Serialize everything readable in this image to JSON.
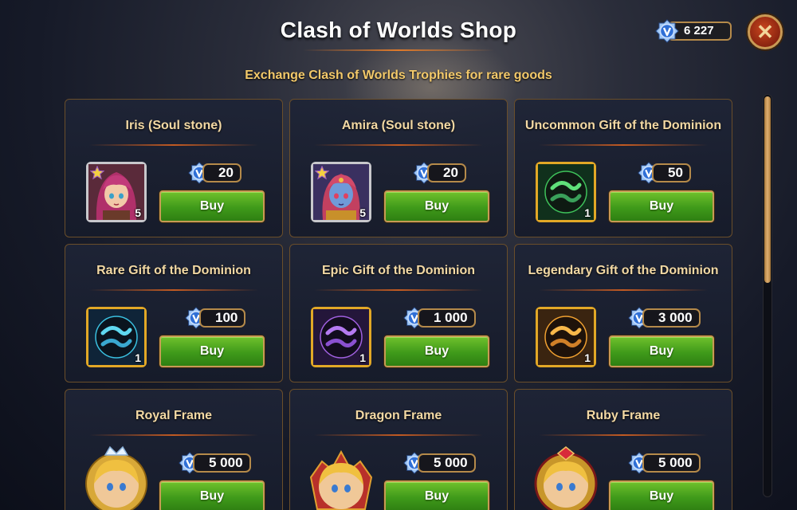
{
  "shop": {
    "title": "Clash of Worlds Shop",
    "subtitle": "Exchange Clash of Worlds Trophies for rare goods",
    "balance": "6 227",
    "buy_label": "Buy"
  },
  "colors": {
    "accent_gold": "#f3c96a",
    "title_gold": "#f3d9a4",
    "buy_green": "#3f9a1a",
    "trophy_blue": "#2f6fd6",
    "frame_gold": "#e2a826",
    "frame_silver": "#c8c8cc"
  },
  "items": [
    {
      "name": "Iris (Soul stone)",
      "price": "20",
      "qty": "5",
      "icon": "iris-portrait-icon"
    },
    {
      "name": "Amira (Soul stone)",
      "price": "20",
      "qty": "5",
      "icon": "amira-portrait-icon"
    },
    {
      "name": "Uncommon Gift of the Dominion",
      "price": "50",
      "qty": "1",
      "icon": "green-orb-icon"
    },
    {
      "name": "Rare Gift of the Dominion",
      "price": "100",
      "qty": "1",
      "icon": "blue-orb-icon"
    },
    {
      "name": "Epic Gift of the Dominion",
      "price": "1 000",
      "qty": "1",
      "icon": "purple-orb-icon"
    },
    {
      "name": "Legendary Gift of the Dominion",
      "price": "3 000",
      "qty": "1",
      "icon": "orange-orb-icon"
    },
    {
      "name": "Royal Frame",
      "price": "5 000",
      "icon": "royal-frame-icon"
    },
    {
      "name": "Dragon Frame",
      "price": "5 000",
      "icon": "dragon-frame-icon"
    },
    {
      "name": "Ruby Frame",
      "price": "5 000",
      "icon": "ruby-frame-icon"
    }
  ]
}
